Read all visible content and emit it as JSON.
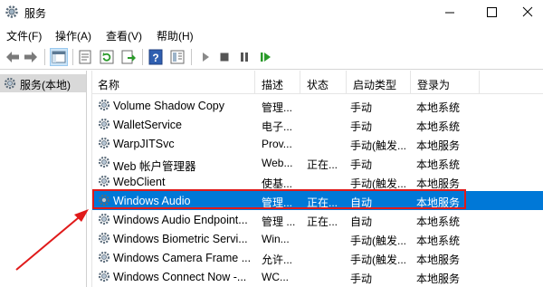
{
  "window": {
    "title": "服务",
    "icon": "gear-icon"
  },
  "menu": [
    "文件(F)",
    "操作(A)",
    "查看(V)",
    "帮助(H)"
  ],
  "toolbar_icons": [
    "back-arrow-icon",
    "forward-arrow-icon",
    "console-tree-icon",
    "properties-icon",
    "refresh-icon",
    "export-icon",
    "help-icon",
    "view-icon",
    "play-icon",
    "stop-icon",
    "pause-icon",
    "restart-icon"
  ],
  "tree": {
    "label": "服务(本地)",
    "icon": "services-icon"
  },
  "columns": [
    "名称",
    "描述",
    "状态",
    "启动类型",
    "登录为"
  ],
  "services": [
    {
      "name": "Volume Shadow Copy",
      "desc": "管理...",
      "status": "",
      "startup": "手动",
      "logon": "本地系统"
    },
    {
      "name": "WalletService",
      "desc": "电子...",
      "status": "",
      "startup": "手动",
      "logon": "本地系统"
    },
    {
      "name": "WarpJITSvc",
      "desc": "Prov...",
      "status": "",
      "startup": "手动(触发...",
      "logon": "本地服务"
    },
    {
      "name": "Web 帐户管理器",
      "desc": "Web...",
      "status": "正在...",
      "startup": "手动",
      "logon": "本地系统"
    },
    {
      "name": "WebClient",
      "desc": "使基...",
      "status": "",
      "startup": "手动(触发...",
      "logon": "本地服务"
    },
    {
      "name": "Windows Audio",
      "desc": "管理...",
      "status": "正在...",
      "startup": "自动",
      "logon": "本地服务",
      "selected": true
    },
    {
      "name": "Windows Audio Endpoint...",
      "desc": "管理 ...",
      "status": "正在...",
      "startup": "自动",
      "logon": "本地系统"
    },
    {
      "name": "Windows Biometric Servi...",
      "desc": "Win...",
      "status": "",
      "startup": "手动(触发...",
      "logon": "本地系统"
    },
    {
      "name": "Windows Camera Frame ...",
      "desc": "允许...",
      "status": "",
      "startup": "手动(触发...",
      "logon": "本地服务"
    },
    {
      "name": "Windows Connect Now -...",
      "desc": "WC...",
      "status": "",
      "startup": "手动",
      "logon": "本地服务"
    }
  ],
  "colors": {
    "selection": "#0078d7",
    "highlight": "#e01a1a"
  }
}
